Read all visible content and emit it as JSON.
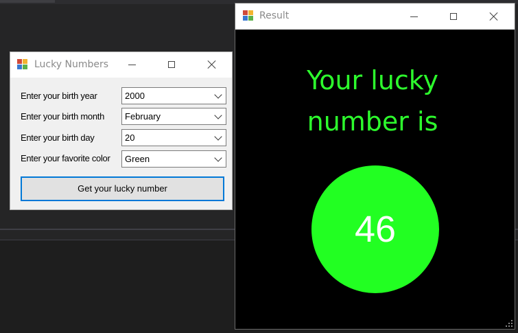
{
  "lucky_window": {
    "title": "Lucky Numbers",
    "fields": [
      {
        "label": "Enter your birth year",
        "value": "2000"
      },
      {
        "label": "Enter your birth month",
        "value": "February"
      },
      {
        "label": "Enter your birth day",
        "value": "20"
      },
      {
        "label": "Enter your favorite color",
        "value": "Green"
      }
    ],
    "button_label": "Get your lucky number"
  },
  "result_window": {
    "title": "Result",
    "headline_line1": "Your lucky",
    "headline_line2": "number is",
    "lucky_number": "46",
    "circle_color": "#22ff22",
    "text_color": "#2dfc2d"
  },
  "icons": [
    "app-icon",
    "minimize-icon",
    "maximize-icon",
    "close-icon",
    "chevron-down-icon",
    "resize-grip-icon"
  ]
}
